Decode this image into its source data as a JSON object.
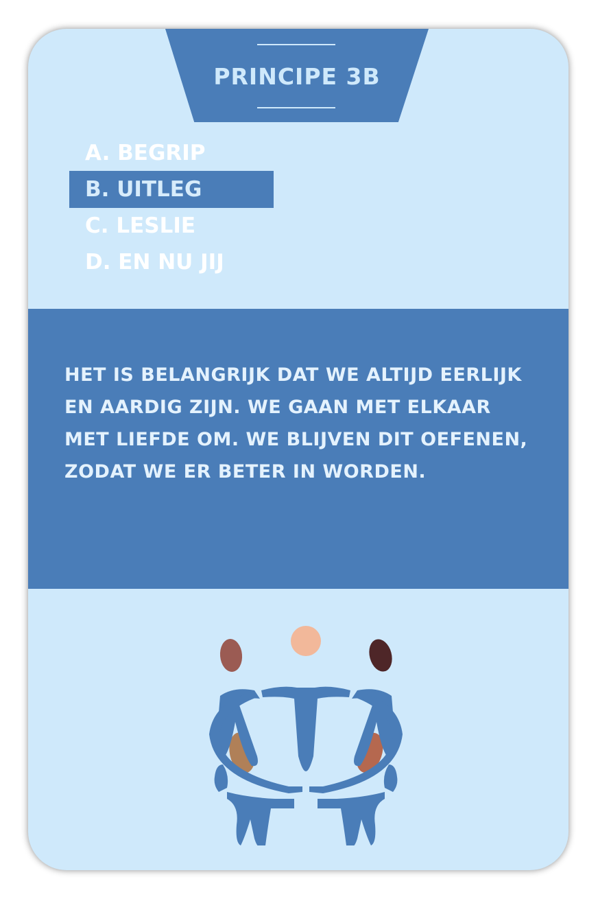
{
  "card": {
    "title": "PRINCIPE 3B",
    "menu": [
      {
        "label": "A. BEGRIP",
        "active": false
      },
      {
        "label": "B. UITLEG",
        "active": true
      },
      {
        "label": "C. LESLIE",
        "active": false
      },
      {
        "label": "D. EN NU JIJ",
        "active": false
      }
    ],
    "body": "HET IS BELANGRIJK DAT WE ALTIJD EERLIJK EN AARDIG ZIJN. WE GAAN MET ELKAAR MET LIEFDE OM. WE BLIJVEN DIT OEFENEN, ZODAT WE ER BETER IN WORDEN.",
    "illustration_icon": "people-circle-icon"
  },
  "colors": {
    "card_background": "#cfe9fb",
    "accent_blue": "#4a7db8",
    "text_light": "#e4f2fd",
    "head_peach": "#f2b89a",
    "head_rust": "#9b5b53",
    "head_dark": "#4e2628",
    "head_tan": "#b08058",
    "head_terracotta": "#b5684f"
  }
}
